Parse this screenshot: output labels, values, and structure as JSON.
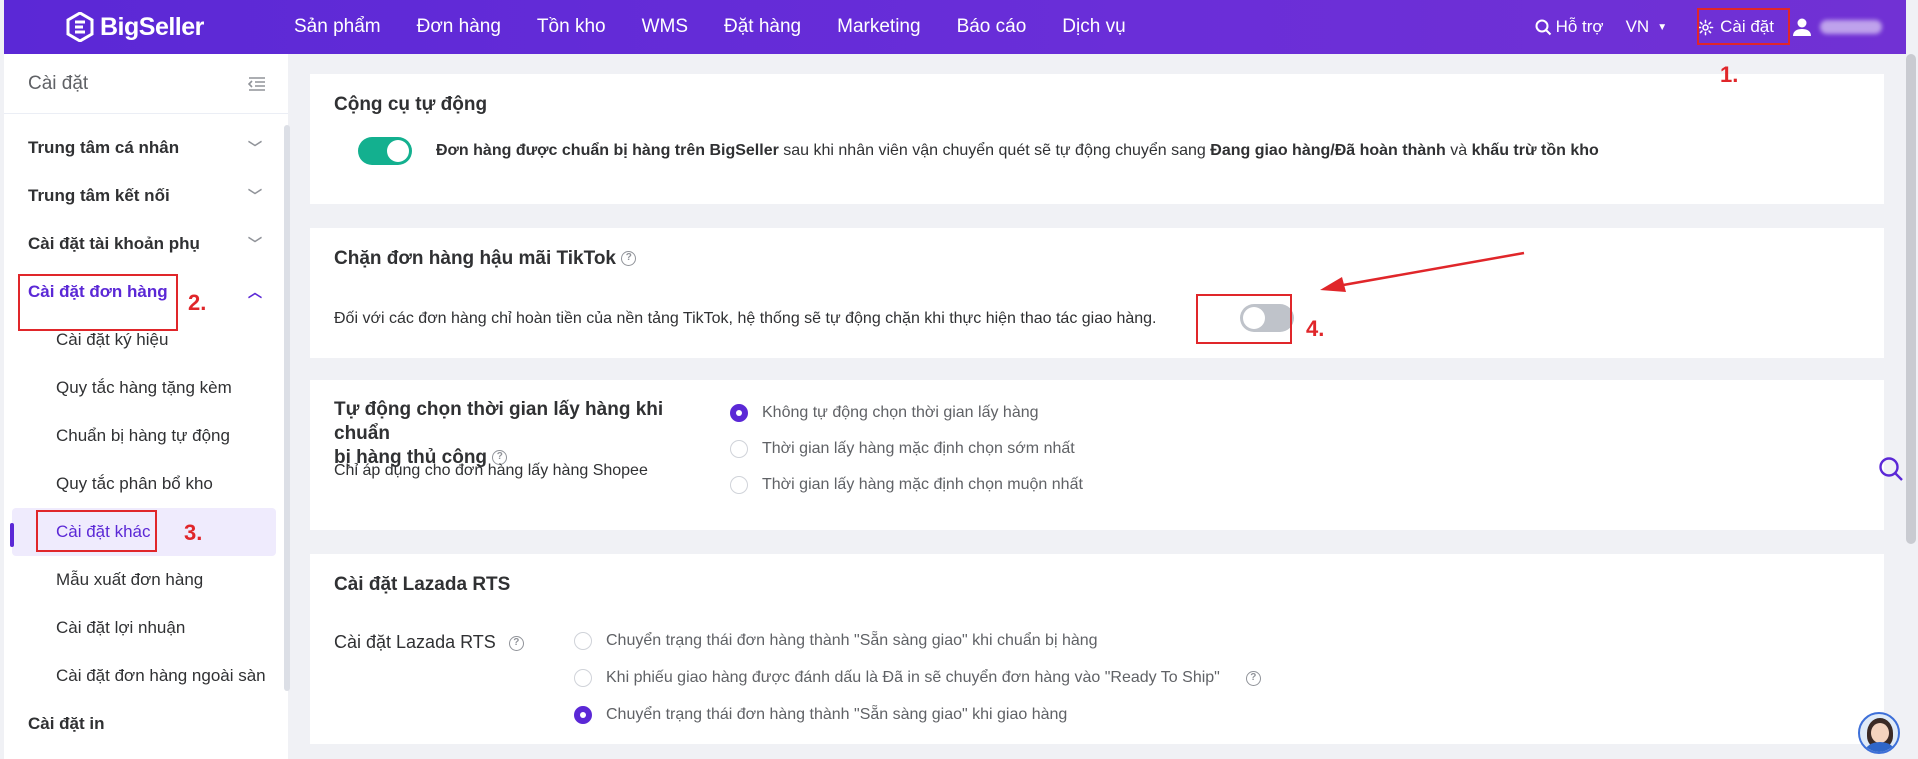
{
  "brand": {
    "name": "BigSeller",
    "accent": "#5b28d6",
    "toggle_on": "#13b08f",
    "highlight": "#e0262a"
  },
  "nav": [
    "Sản phẩm",
    "Đơn hàng",
    "Tồn kho",
    "WMS",
    "Đặt hàng",
    "Marketing",
    "Báo cáo",
    "Dịch vụ"
  ],
  "top_right": {
    "help": "Hỗ trợ",
    "lang": "VN",
    "settings": "Cài đặt"
  },
  "steps": [
    "1.",
    "2.",
    "3.",
    "4."
  ],
  "sidebar": {
    "title": "Cài đặt",
    "groups": [
      {
        "label": "Trung tâm cá nhân"
      },
      {
        "label": "Trung tâm kết nối"
      },
      {
        "label": "Cài đặt tài khoản phụ"
      },
      {
        "label": "Cài đặt đơn hàng"
      }
    ],
    "items": [
      "Cài đặt ký hiệu",
      "Quy tắc hàng tặng kèm",
      "Chuẩn bị hàng tự động",
      "Quy tắc phân bổ kho",
      "Cài đặt khác",
      "Mẫu xuất đơn hàng",
      "Cài đặt lợi nhuận",
      "Cài đặt đơn hàng ngoài sàn"
    ],
    "last_group": "Cài đặt in"
  },
  "cards": {
    "auto_tools": {
      "title": "Cộng cụ tự động",
      "toggle_on": true,
      "text_b1": "Đơn hàng được chuẩn bị hàng trên BigSeller",
      "text_1": " sau khi nhân viên vận chuyển quét sẽ tự động chuyển sang ",
      "text_b2": "Đang giao hàng/Đã hoàn thành",
      "text_2": " và ",
      "text_b3": "khấu trừ tồn kho"
    },
    "tiktok": {
      "title": "Chặn đơn hàng hậu mãi TikTok",
      "desc": "Đối với các đơn hàng chỉ hoàn tiền của nền tảng TikTok, hệ thống sẽ tự động chặn khi thực hiện thao tác giao hàng.",
      "toggle_on": false
    },
    "pickup": {
      "title_line1": "Tự động chọn thời gian lấy hàng khi chuẩn",
      "title_line2": "bị hàng thủ công",
      "note": "Chỉ áp dụng cho đơn hàng lấy hàng Shopee",
      "options": [
        "Không tự động chọn thời gian lấy hàng",
        "Thời gian lấy hàng mặc định chọn sớm nhất",
        "Thời gian lấy hàng mặc định chọn muộn nhất"
      ],
      "selected": 0
    },
    "lazada": {
      "title": "Cài đặt Lazada RTS",
      "label": "Cài đặt Lazada RTS",
      "options": [
        "Chuyển trạng thái đơn hàng thành \"Sẵn sàng giao\" khi chuẩn bị hàng",
        "Khi phiếu giao hàng được đánh dấu là Đã in sẽ chuyển đơn hàng vào \"Ready To Ship\"",
        "Chuyển trạng thái đơn hàng thành \"Sẵn sàng giao\" khi giao hàng"
      ],
      "selected": 2
    }
  }
}
